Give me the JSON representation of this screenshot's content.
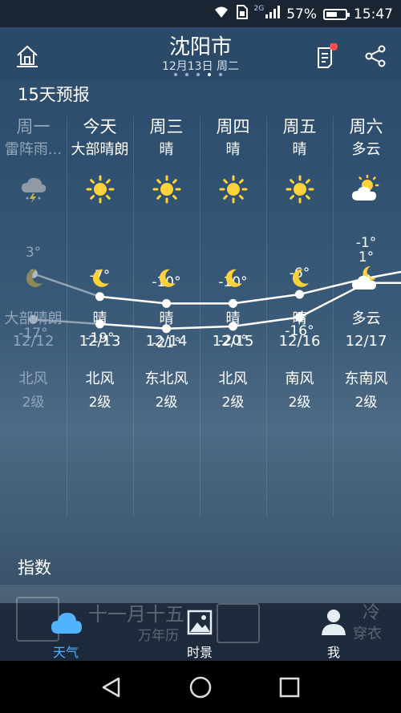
{
  "status": {
    "network": "2G",
    "battery": "57%",
    "battery_level": 0.57,
    "time": "15:47"
  },
  "header": {
    "city": "沈阳市",
    "date": "12月13日 周二",
    "page_count": 5,
    "active_page": 4
  },
  "forecast": {
    "title": "15天预报",
    "days": [
      {
        "name": "周一",
        "day_cond": "雷阵雨...",
        "day_icon": "thunder-rain-icon",
        "high": "3°",
        "low": "-17°",
        "night_icon": "moon-icon",
        "night_cond": "大部晴朗",
        "date": "12/12",
        "wind_dir": "北风",
        "wind_level": "2级"
      },
      {
        "name": "今天",
        "day_cond": "大部晴朗",
        "day_icon": "sun-icon",
        "high": "-7°",
        "low": "-19°",
        "night_icon": "moon-icon",
        "night_cond": "晴",
        "date": "12/13",
        "wind_dir": "北风",
        "wind_level": "2级"
      },
      {
        "name": "周三",
        "day_cond": "晴",
        "day_icon": "sun-icon",
        "high": "-10°",
        "low": "-21°",
        "night_icon": "moon-icon",
        "night_cond": "晴",
        "date": "12/14",
        "wind_dir": "东北风",
        "wind_level": "2级"
      },
      {
        "name": "周四",
        "day_cond": "晴",
        "day_icon": "sun-icon",
        "high": "-10°",
        "low": "-20°",
        "night_icon": "moon-icon",
        "night_cond": "晴",
        "date": "12/15",
        "wind_dir": "北风",
        "wind_level": "2级"
      },
      {
        "name": "周五",
        "day_cond": "晴",
        "day_icon": "sun-icon",
        "high": "-6°",
        "low": "-16°",
        "night_icon": "moon-icon",
        "night_cond": "晴",
        "date": "12/16",
        "wind_dir": "南风",
        "wind_level": "2级"
      },
      {
        "name": "周六",
        "day_cond": "多云",
        "day_icon": "sun-cloud-icon",
        "high": "1°",
        "low": "-1°",
        "night_icon": "moon-cloud-icon",
        "night_cond": "多云",
        "date": "12/17",
        "wind_dir": "东南风",
        "wind_level": "2级"
      }
    ]
  },
  "chart_data": {
    "type": "line",
    "categories": [
      "12/12",
      "12/13",
      "12/14",
      "12/15",
      "12/16",
      "12/17"
    ],
    "series": [
      {
        "values": [
          3,
          -7,
          -10,
          -10,
          -6,
          1
        ]
      },
      {
        "values": [
          -17,
          -19,
          -21,
          -20,
          -16,
          -1
        ]
      }
    ],
    "ylabel": "",
    "xlabel": "",
    "title": ""
  },
  "index": {
    "title": "指数"
  },
  "behind_text": {
    "lunar": "十一月十五",
    "almanac": "万年历",
    "cold": "冷",
    "dress": "穿衣"
  },
  "tabs": [
    {
      "label": "天气",
      "icon": "cloud-icon",
      "active": true
    },
    {
      "label": "时景",
      "icon": "photo-icon",
      "active": false
    },
    {
      "label": "我",
      "icon": "person-icon",
      "active": false
    }
  ],
  "colors": {
    "active_tab": "#4fb3ff",
    "sun": "#ffd23a",
    "notification_dot": "#ff4d4d"
  }
}
